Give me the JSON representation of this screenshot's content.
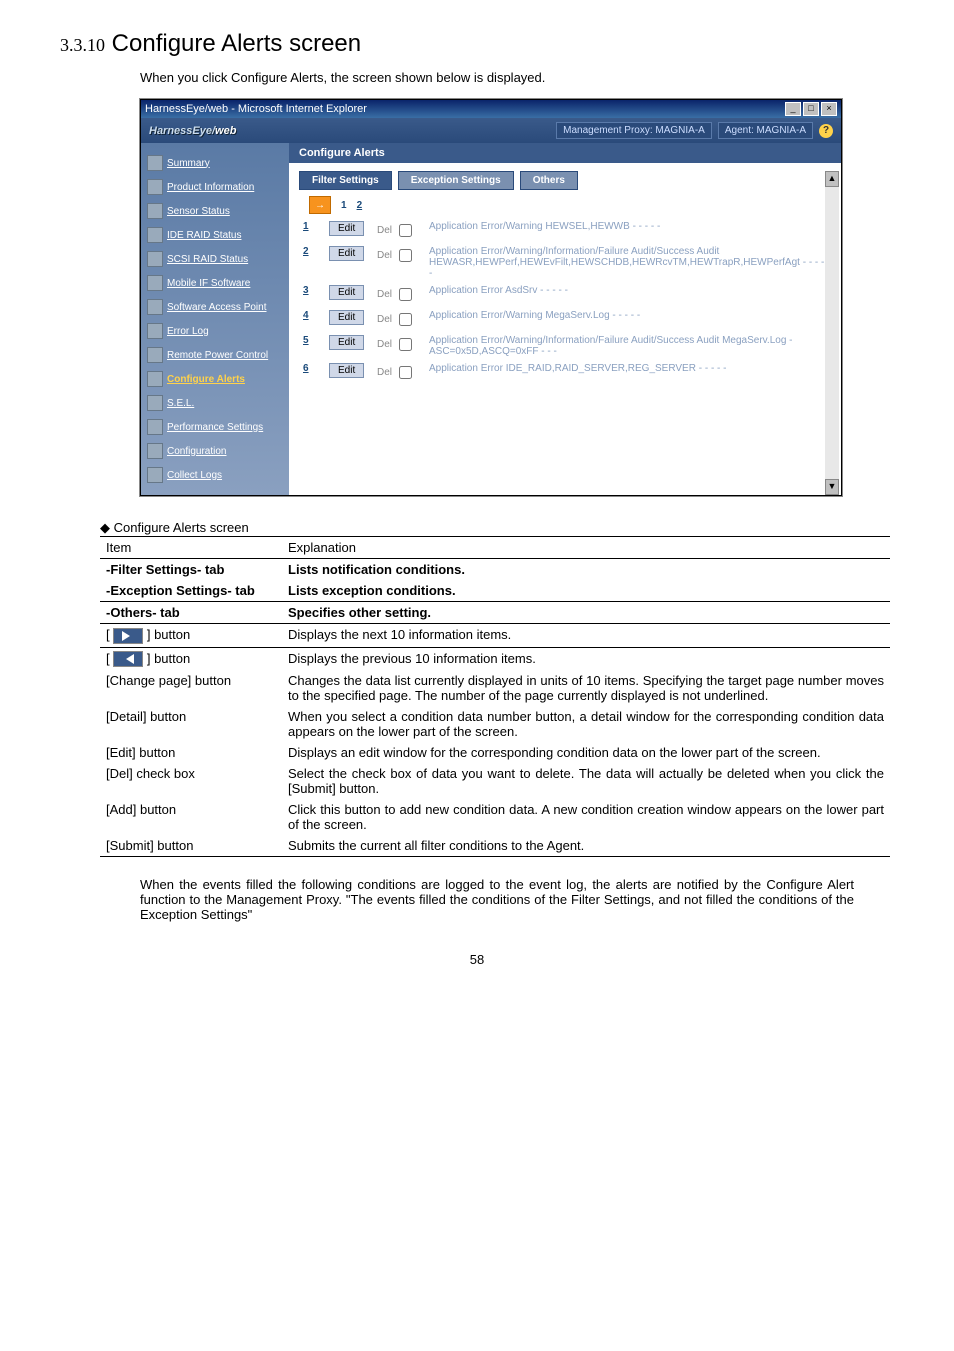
{
  "heading_num": "3.3.10",
  "heading_text": "Configure Alerts screen",
  "intro": "When you click Configure Alerts, the screen shown below is displayed.",
  "ie": {
    "title": "HarnessEye/web - Microsoft Internet Explorer",
    "logo1": "HarnessEye/",
    "logo2": "web",
    "mgmt_proxy": "Management Proxy: MAGNIA-A",
    "agent": "Agent: MAGNIA-A",
    "help": "?",
    "section_title": "Configure Alerts",
    "tabs": {
      "filter": "Filter Settings",
      "exception": "Exception Settings",
      "others": "Others"
    },
    "pager": {
      "arrow": "→",
      "page1": "1",
      "page2": "2"
    },
    "edit_label": "Edit",
    "del_label": "Del",
    "sidebar": [
      "Summary",
      "Product Information",
      "Sensor Status",
      "IDE RAID Status",
      "SCSI RAID Status",
      "Mobile IF Software",
      "Software Access Point",
      "Error Log",
      "Remote Power Control",
      "Configure Alerts",
      "S.E.L.",
      "Performance Settings",
      "Configuration",
      "Collect Logs"
    ],
    "sidebar_active_index": 9,
    "rows": [
      {
        "n": "1",
        "desc": "Application Error/Warning HEWSEL,HEWWB - - - - -"
      },
      {
        "n": "2",
        "desc": "Application Error/Warning/Information/Failure Audit/Success Audit HEWASR,HEWPerf,HEWEvFilt,HEWSCHDB,HEWRcvTM,HEWTrapR,HEWPerfAgt - - - - -"
      },
      {
        "n": "3",
        "desc": "Application Error AsdSrv - - - - -"
      },
      {
        "n": "4",
        "desc": "Application Error/Warning MegaServ.Log - - - - -"
      },
      {
        "n": "5",
        "desc": "Application Error/Warning/Information/Failure Audit/Success Audit MegaServ.Log - ASC=0x5D,ASCQ=0xFF - - -"
      },
      {
        "n": "6",
        "desc": "Application Error IDE_RAID,RAID_SERVER,REG_SERVER - - - - -"
      }
    ]
  },
  "subheader": "Configure Alerts screen",
  "table": {
    "h_item": "Item",
    "h_expl": "Explanation",
    "rows": [
      {
        "item": "-Filter Settings- tab",
        "expl": "Lists notification conditions.",
        "bold": true
      },
      {
        "item": "-Exception Settings- tab",
        "expl": "Lists exception conditions.",
        "bold": true
      },
      {
        "item": "-Others- tab",
        "expl": "Specifies other setting.",
        "bold": true,
        "topline": true
      },
      {
        "item": "[→] button",
        "expl": "Displays the next 10 information items.",
        "arrow": "right",
        "topline": true
      },
      {
        "item": "[←] button",
        "expl": "Displays the previous 10 information items.",
        "arrow": "left",
        "topline": true
      },
      {
        "item": "[Change page] button",
        "expl": "Changes the data list currently displayed in units of 10 items. Specifying the target page number moves to the specified page. The number of the page currently displayed is not underlined."
      },
      {
        "item": "[Detail] button",
        "expl": "When you select a condition data number button, a detail window for the corresponding condition data appears on the lower part of the screen."
      },
      {
        "item": "[Edit] button",
        "expl": "Displays an edit window for the corresponding condition data on the lower part of the screen."
      },
      {
        "item": "[Del] check box",
        "expl": "Select the check box of data you want to delete. The data will actually be deleted when you click the [Submit] button."
      },
      {
        "item": "[Add] button",
        "expl": "Click this button to add new condition data. A new condition creation window appears on the lower part of the screen."
      },
      {
        "item": "[Submit] button",
        "expl": "Submits the current all filter conditions to the Agent.",
        "bottomline": true
      }
    ]
  },
  "footnote": "When the events filled the following conditions are logged to the event log, the alerts are notified by the Configure Alert function to the Management Proxy. \"The events filled the conditions of the Filter Settings, and not filled the conditions of the Exception Settings\"",
  "page_number": "58"
}
